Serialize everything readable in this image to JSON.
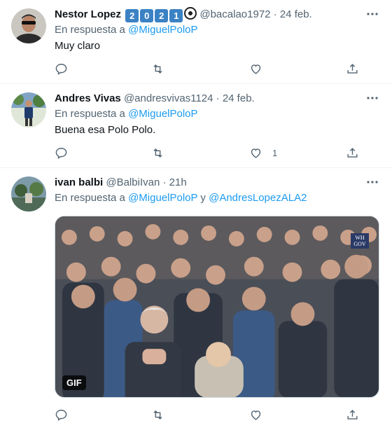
{
  "tweets": [
    {
      "name": "Nestor Lopez",
      "badges": [
        "2",
        "0",
        "2",
        "1"
      ],
      "handle": "@bacalao1972",
      "dot": "·",
      "time": "24 feb.",
      "reply_prefix": "En respuesta a",
      "reply_to": "@MiguelPoloP",
      "text": "Muy claro",
      "likes": "",
      "avatar_icon": "avatar-man-sunglasses"
    },
    {
      "name": "Andres Vivas",
      "handle": "@andresvivas1124",
      "dot": "·",
      "time": "24 feb.",
      "reply_prefix": "En respuesta a",
      "reply_to": "@MiguelPoloP",
      "text": "Buena esa Polo Polo.",
      "likes": "1",
      "avatar_icon": "avatar-man-standing"
    },
    {
      "name": "ivan balbi",
      "handle": "@BalbiIvan",
      "dot": "·",
      "time": "21h",
      "reply_prefix": "En respuesta a",
      "reply_to": "@MiguelPoloP",
      "reply_join": "y",
      "reply_to_2": "@AndresLopezALA2",
      "media_badge": "GIF",
      "media_watermark": [
        "WH",
        "GOV"
      ],
      "likes": "",
      "avatar_icon": "avatar-landscape"
    }
  ],
  "icons": {
    "more": "more-horizontal-icon",
    "reply": "reply-icon",
    "retweet": "retweet-icon",
    "like": "heart-icon",
    "share": "share-icon"
  },
  "colors": {
    "link": "#1d9bf0",
    "secondary": "#536471",
    "divider": "#eff3f4"
  }
}
